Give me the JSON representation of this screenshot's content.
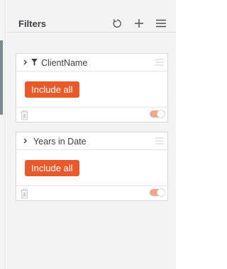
{
  "filters_panel": {
    "title": "Filters",
    "icons": {
      "reset": "reset-icon",
      "add": "plus-icon",
      "menu": "menu-icon"
    }
  },
  "filters": [
    {
      "label": "ClientName",
      "has_funnel": true,
      "button_label": "Include all",
      "toggle_on": true
    },
    {
      "label": "Years in Date",
      "has_funnel": false,
      "button_label": "Include all",
      "toggle_on": true
    }
  ],
  "colors": {
    "accent": "#e8592b",
    "toggle_track": "#f0a58d",
    "panel_bg": "#f3f3f3",
    "side_accent": "#7d8a8d"
  }
}
